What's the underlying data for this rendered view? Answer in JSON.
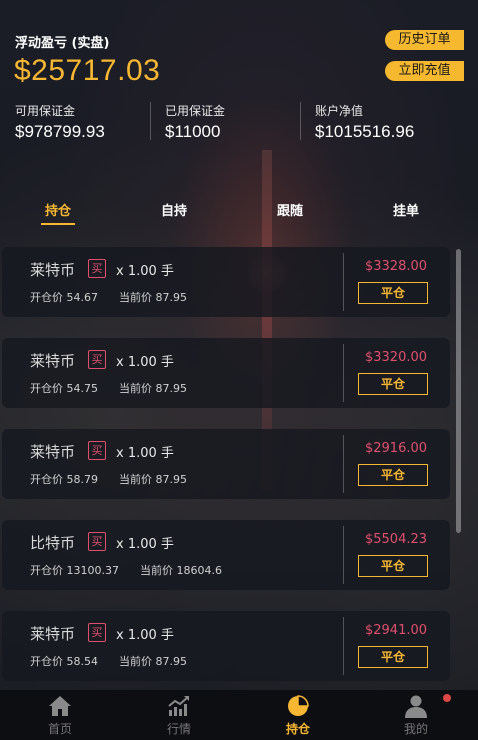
{
  "header": {
    "mode_label": "浮动盈亏 (实盘)",
    "floating_pl": "$25717.03",
    "history_button": "历史订单",
    "recharge_button": "立即充值",
    "stats": [
      {
        "label": "可用保证金",
        "value": "$978799.93"
      },
      {
        "label": "已用保证金",
        "value": "$11000"
      },
      {
        "label": "账户净值",
        "value": "$1015516.96"
      }
    ]
  },
  "tabs": [
    {
      "label": "持仓",
      "active": true
    },
    {
      "label": "自持",
      "active": false
    },
    {
      "label": "跟随",
      "active": false
    },
    {
      "label": "挂单",
      "active": false
    }
  ],
  "positions": [
    {
      "name": "莱特币",
      "side": "买",
      "qty": "x 1.00 手",
      "open_label": "开仓价",
      "open_price": "54.67",
      "current_label": "当前价",
      "current_price": "87.95",
      "profit": "$3328.00",
      "close_label": "平仓"
    },
    {
      "name": "莱特币",
      "side": "买",
      "qty": "x 1.00 手",
      "open_label": "开仓价",
      "open_price": "54.75",
      "current_label": "当前价",
      "current_price": "87.95",
      "profit": "$3320.00",
      "close_label": "平仓"
    },
    {
      "name": "莱特币",
      "side": "买",
      "qty": "x 1.00 手",
      "open_label": "开仓价",
      "open_price": "58.79",
      "current_label": "当前价",
      "current_price": "87.95",
      "profit": "$2916.00",
      "close_label": "平仓"
    },
    {
      "name": "比特币",
      "side": "买",
      "qty": "x 1.00 手",
      "open_label": "开仓价",
      "open_price": "13100.37",
      "current_label": "当前价",
      "current_price": "18604.6",
      "profit": "$5504.23",
      "close_label": "平仓"
    },
    {
      "name": "莱特币",
      "side": "买",
      "qty": "x 1.00 手",
      "open_label": "开仓价",
      "open_price": "58.54",
      "current_label": "当前价",
      "current_price": "87.95",
      "profit": "$2941.00",
      "close_label": "平仓"
    }
  ],
  "bottom_nav": [
    {
      "label": "首页",
      "icon": "home-icon",
      "active": false
    },
    {
      "label": "行情",
      "icon": "chart-icon",
      "active": false
    },
    {
      "label": "持仓",
      "icon": "pie-icon",
      "active": true
    },
    {
      "label": "我的",
      "icon": "user-icon",
      "active": false
    }
  ],
  "colors": {
    "accent": "#f7b733",
    "profit": "#e0506e",
    "background": "#14161d"
  }
}
